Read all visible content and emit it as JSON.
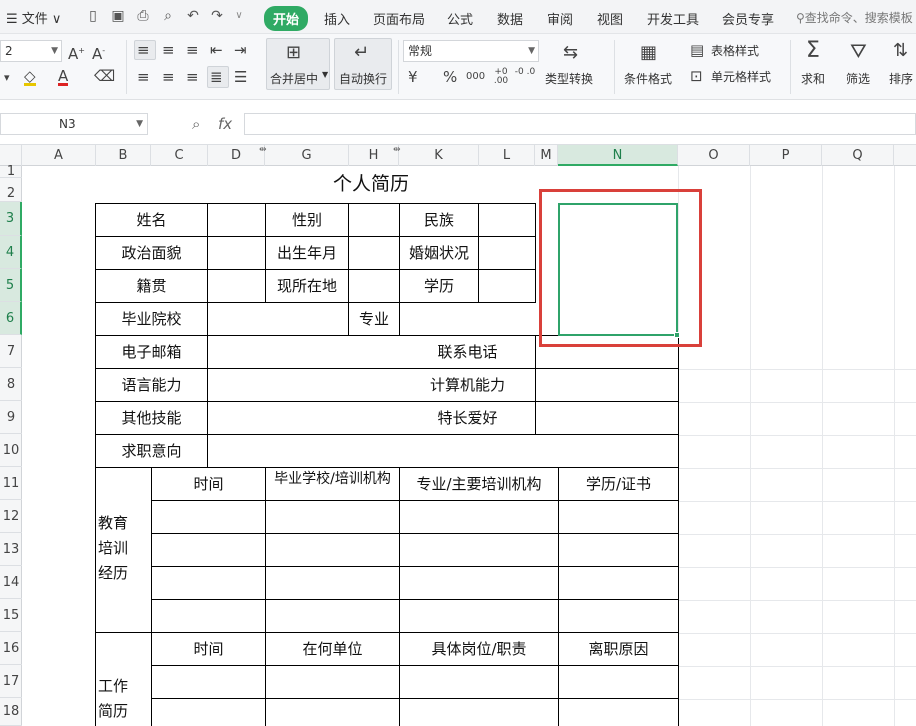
{
  "menubar": {
    "file_label": "☰ 文件 ∨",
    "tabs": [
      "开始",
      "插入",
      "页面布局",
      "公式",
      "数据",
      "审阅",
      "视图",
      "开发工具",
      "会员专享"
    ],
    "active_tab": "开始",
    "search_placeholder": "查找命令、搜索模板"
  },
  "ribbon": {
    "font_size_value": "2",
    "number_format": "常规",
    "merge_label": "合并居中",
    "wrap_label": "自动换行",
    "type_convert_label": "类型转换",
    "cond_format_label": "条件格式",
    "table_style_label": "表格样式",
    "cell_style_label": "单元格样式",
    "sum_label": "求和",
    "filter_label": "筛选",
    "sort_label": "排序",
    "currency_symbol": "¥",
    "percent_symbol": "%",
    "thousands_symbol": "000",
    "dec_inc": "+0 .00",
    "dec_dec": "-0 .0"
  },
  "formula_bar": {
    "name_box": "N3",
    "fx_label": "fx",
    "formula": ""
  },
  "columns": [
    "A",
    "B",
    "C",
    "D",
    "G",
    "H",
    "K",
    "L",
    "M",
    "N",
    "O",
    "P",
    "Q"
  ],
  "selected_column": "N",
  "rows": [
    "1",
    "2",
    "3",
    "4",
    "5",
    "6",
    "7",
    "8",
    "9",
    "10",
    "11",
    "12",
    "13",
    "14",
    "15",
    "16",
    "17",
    "18"
  ],
  "selected_rows": [
    "3",
    "4",
    "5",
    "6"
  ],
  "sheet": {
    "title": "个人简历",
    "name_label": "姓名",
    "gender_label": "性别",
    "ethnicity_label": "民族",
    "political_label": "政治面貌",
    "birth_label": "出生年月",
    "marital_label": "婚姻状况",
    "native_label": "籍贯",
    "residence_label": "现所在地",
    "education_label": "学历",
    "school_label": "毕业院校",
    "major_label": "专业",
    "email_label": "电子邮箱",
    "phone_label": "联系电话",
    "language_label": "语言能力",
    "computer_label": "计算机能力",
    "skills_label": "其他技能",
    "hobby_label": "特长爱好",
    "intent_label": "求职意向",
    "edu_section": "教育\n培训\n经历",
    "edu_time": "时间",
    "edu_school": "毕业学校/培训机构",
    "edu_major": "专业/主要培训机构",
    "edu_degree": "学历/证书",
    "work_section": "工作\n简历",
    "work_time": "时间",
    "work_company": "在何单位",
    "work_position": "具体岗位/职责",
    "work_reason": "离职原因"
  },
  "colors": {
    "accent": "#2faa64",
    "annotation_red": "#d9403a",
    "selection_green": "#2fa36a"
  }
}
